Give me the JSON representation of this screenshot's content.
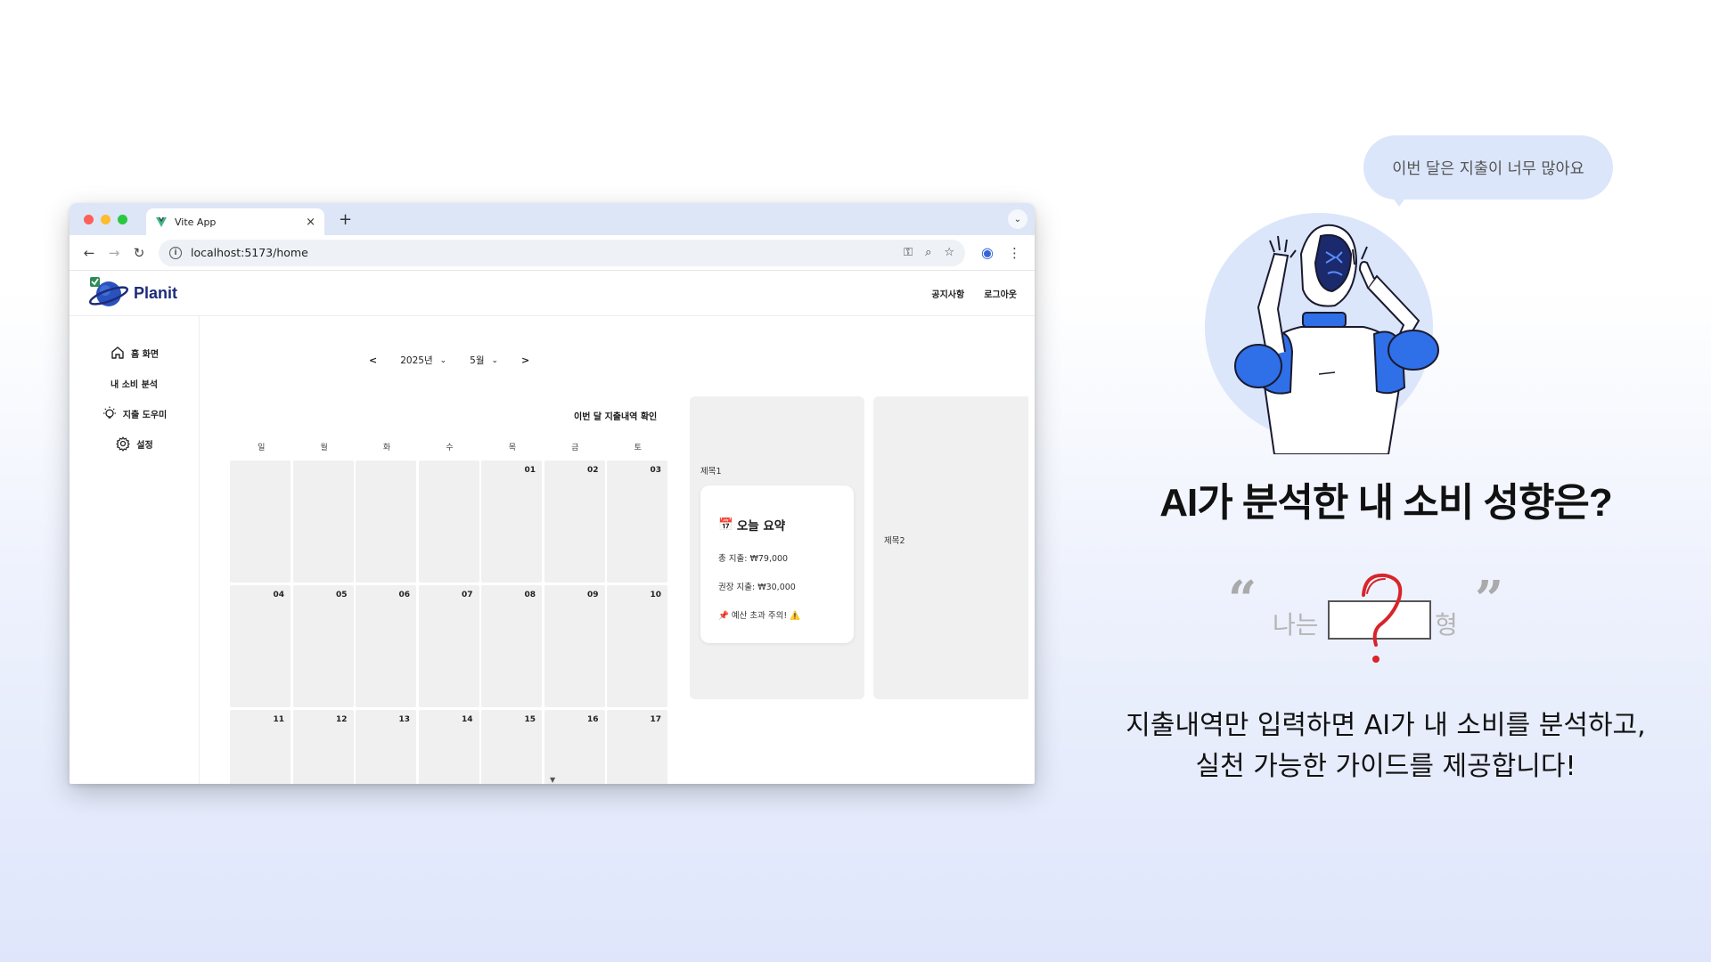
{
  "browser": {
    "tab_title": "Vite App",
    "tab_close": "×",
    "new_tab": "+",
    "url": "localhost:5173/home"
  },
  "app": {
    "brand": "Planit",
    "header_links": [
      "공지사항",
      "로그아웃"
    ],
    "sidebar": [
      {
        "label": "홈 화면",
        "icon": "home-icon"
      },
      {
        "label": "내 소비 분석",
        "icon": ""
      },
      {
        "label": "지출 도우미",
        "icon": "lightbulb-icon"
      },
      {
        "label": "설정",
        "icon": "gear-icon"
      }
    ],
    "month_nav": {
      "prev": "<",
      "year": "2025년",
      "month": "5월",
      "next": ">"
    },
    "calendar_title": "이번 달 지출내역 확인",
    "weekdays": [
      "일",
      "월",
      "화",
      "수",
      "목",
      "금",
      "토"
    ],
    "days": [
      "",
      "",
      "",
      "",
      "01",
      "02",
      "03",
      "04",
      "05",
      "06",
      "07",
      "08",
      "09",
      "10",
      "11",
      "12",
      "13",
      "14",
      "15",
      "16",
      "17"
    ],
    "panel1_title": "제목1",
    "panel2_title": "제목2",
    "summary": {
      "heading": "오늘 요약",
      "total": "총 지출: ₩79,000",
      "recommended": "권장 지출: ₩30,000",
      "warning": "📌 예산 초과 주의! ⚠️"
    }
  },
  "promo": {
    "bubble": "이번 달은 지출이 너무 많아요",
    "headline": "AI가 분석한 내 소비 성향은?",
    "quote_prefix": "나는",
    "quote_suffix": "형",
    "description_line1": "지출내역만 입력하면 AI가 내 소비를 분석하고,",
    "description_line2": "실천 가능한 가이드를 제공합니다!"
  },
  "colors": {
    "accent_blue": "#2f6fe8",
    "bubble_bg": "#dbe6fb",
    "question_red": "#d8242b"
  }
}
